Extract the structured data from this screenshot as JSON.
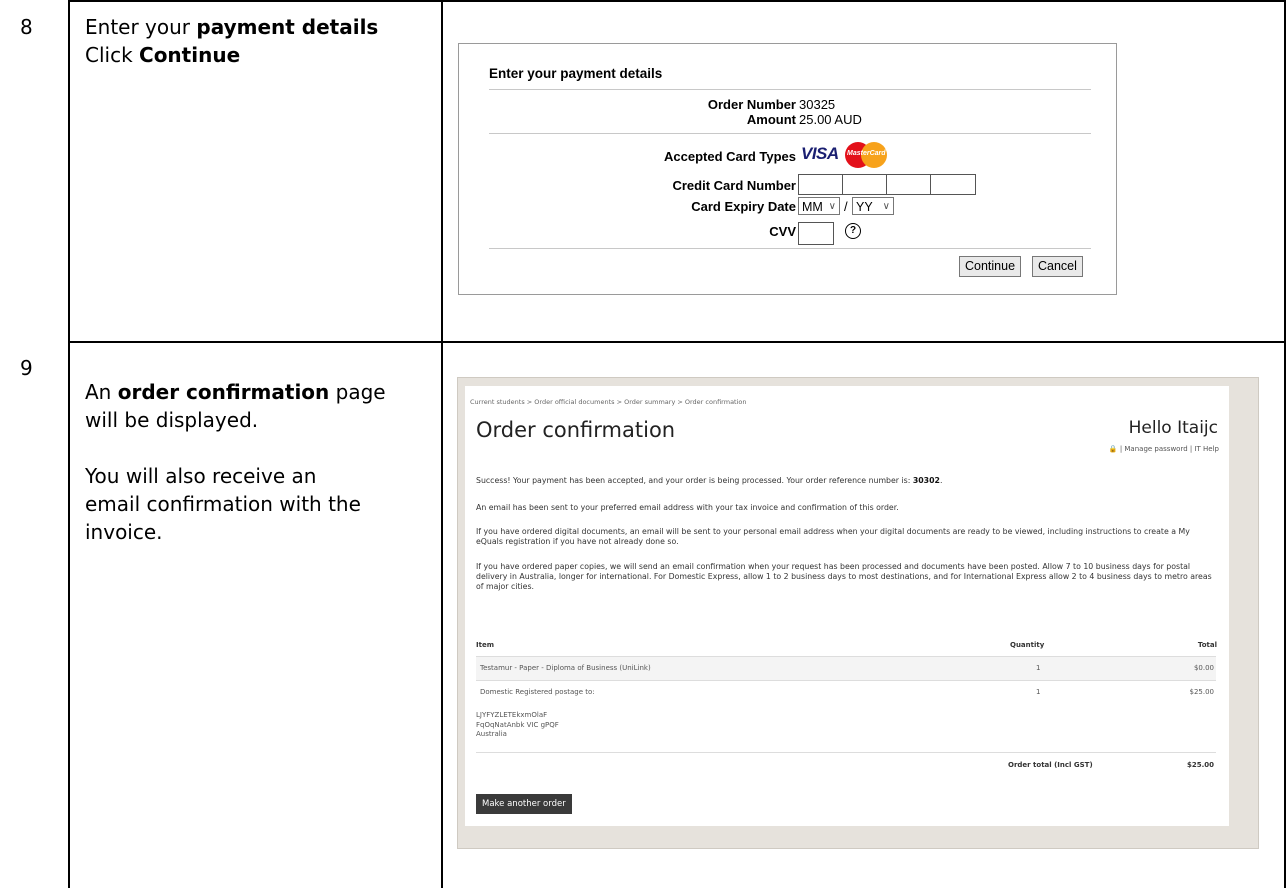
{
  "steps": [
    {
      "number": "8",
      "line1_prefix": "Enter your ",
      "line1_bold": "payment details",
      "line2_prefix": "Click ",
      "line2_bold": "Continue"
    },
    {
      "number": "9",
      "p1_prefix": "An ",
      "p1_bold": "order confirmation",
      "p1_suffix_1": " page",
      "p1_suffix_2": "will be displayed.",
      "p2_line1": "You will also receive an",
      "p2_line2": "email confirmation with the",
      "p2_line3": "invoice."
    }
  ],
  "payment_screen": {
    "title": "Enter your payment details",
    "order_number_label": "Order Number",
    "order_number": "30325",
    "amount_label": "Amount",
    "amount": "25.00  AUD",
    "card_types_label": "Accepted Card Types",
    "visa": "VISA",
    "mastercard": "MasterCard",
    "card_number_label": "Credit Card Number",
    "expiry_label": "Card Expiry Date",
    "expiry_month": "MM",
    "expiry_sep": "/",
    "expiry_year": "YY",
    "cvv_label": "CVV",
    "continue_button": "Continue",
    "cancel_button": "Cancel"
  },
  "confirmation_screen": {
    "breadcrumb": "Current students  >  Order official documents  >  Order summary  >  Order confirmation",
    "title": "Order confirmation",
    "greeting": "Hello Itaijc",
    "user_links": "| Manage password | IT Help",
    "success_text": "Success! Your payment has been accepted, and your order is being processed. Your order reference number is: ",
    "order_reference": "30302",
    "email_text": "An email has been sent to your preferred email address with your tax invoice and confirmation of this order.",
    "digital_text": "If you have ordered digital documents, an email will be sent to your personal email address when your digital documents are ready to be viewed, including instructions to create a My eQuals registration if you have not already done so.",
    "paper_text": "If you have ordered paper copies, we will send an email confirmation when your request has been processed and documents have been posted. Allow 7 to 10 business days for postal delivery in Australia, longer for international. For Domestic Express, allow 1 to 2 business days to most destinations, and for International Express allow 2 to 4 business days to metro areas of major cities.",
    "columns": [
      "Item",
      "Quantity",
      "Total"
    ],
    "rows": [
      {
        "item": "Testamur - Paper - Diploma of Business (UniLink)",
        "quantity": "1",
        "total": "$0.00"
      },
      {
        "item": "Domestic Registered postage to:",
        "quantity": "1",
        "total": "$25.00"
      }
    ],
    "address_lines": [
      "LJYFYZLETEkxmOlaF",
      "FqOqNatAnbk VIC gPQF",
      "Australia"
    ],
    "order_total_label": "Order total (Incl GST)",
    "order_total": "$25.00",
    "make_order_button": "Make another order"
  }
}
